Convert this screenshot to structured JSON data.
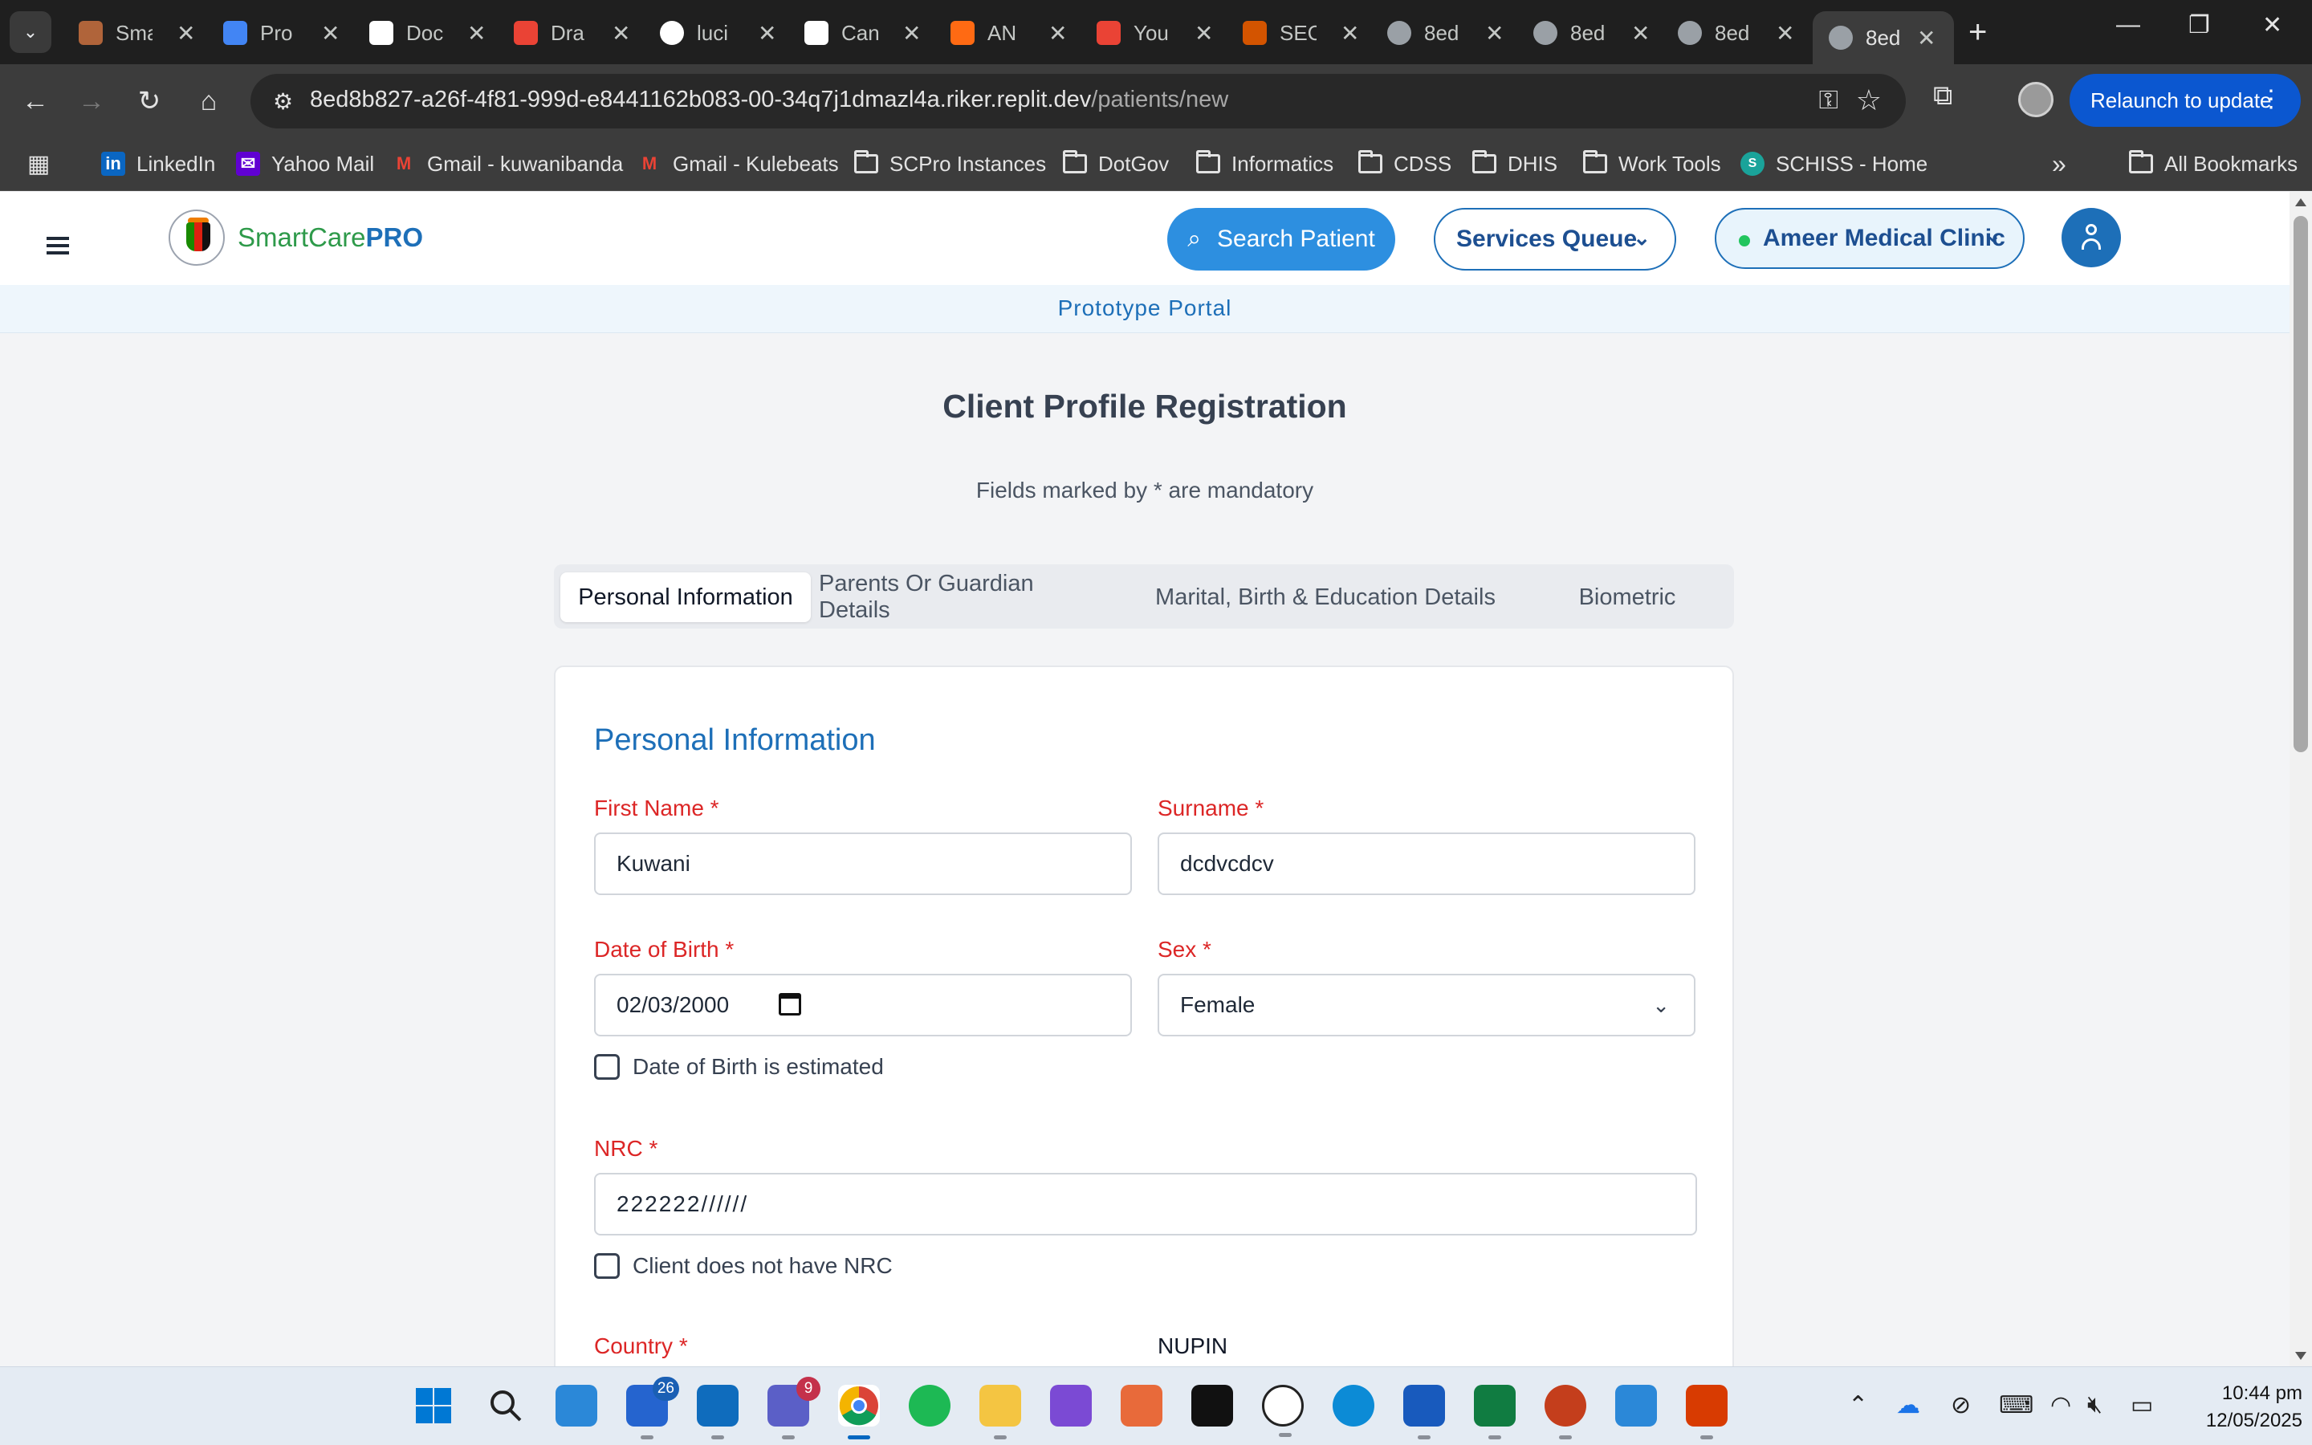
{
  "browser": {
    "tabs": [
      {
        "title": "Sma",
        "favicon_color": "#b0643a"
      },
      {
        "title": "Pro",
        "favicon_color": "#4285f4"
      },
      {
        "title": "Doc",
        "favicon_color": "#ffffff"
      },
      {
        "title": "Dra",
        "favicon_color": "#ea4335"
      },
      {
        "title": "luci",
        "favicon_color": "#ffffff"
      },
      {
        "title": "Can",
        "favicon_color": "#ffffff"
      },
      {
        "title": "AN",
        "favicon_color": "#ff6a13"
      },
      {
        "title": "You",
        "favicon_color": "#ea4335"
      },
      {
        "title": "SEC",
        "favicon_color": "#d35400"
      },
      {
        "title": "8ed",
        "favicon_color": "#9aa0a6"
      },
      {
        "title": "8ed",
        "favicon_color": "#9aa0a6"
      },
      {
        "title": "8ed",
        "favicon_color": "#9aa0a6"
      },
      {
        "title": "8ed",
        "favicon_color": "#9aa0a6",
        "active": true
      }
    ],
    "url_host": "8ed8b827-a26f-4f81-999d-e8441162b083-00-34q7j1dmazl4a.riker.replit.dev",
    "url_path": "/patients/new",
    "relaunch_label": "Relaunch to update",
    "bookmarks": [
      {
        "label": "LinkedIn",
        "icon": "linkedin-icon"
      },
      {
        "label": "Yahoo Mail",
        "icon": "yahoo-icon"
      },
      {
        "label": "Gmail - kuwanibanda",
        "icon": "gmail-icon"
      },
      {
        "label": "Gmail - Kulebeats",
        "icon": "gmail-icon"
      },
      {
        "label": "SCPro Instances",
        "icon": "folder-icon"
      },
      {
        "label": "DotGov",
        "icon": "folder-icon"
      },
      {
        "label": "Informatics",
        "icon": "folder-icon"
      },
      {
        "label": "CDSS",
        "icon": "folder-icon"
      },
      {
        "label": "DHIS",
        "icon": "folder-icon"
      },
      {
        "label": "Work Tools",
        "icon": "folder-icon"
      },
      {
        "label": "SCHISS - Home",
        "icon": "schiss-icon"
      }
    ],
    "all_bookmarks": "All Bookmarks"
  },
  "app": {
    "brand_main": "SmartCare",
    "brand_bold": "PRO",
    "search_patient": "Search Patient",
    "services_queue": "Services Queue",
    "clinic": "Ameer Medical Clinic",
    "portal": "Prototype Portal"
  },
  "form": {
    "title": "Client Profile Registration",
    "subtitle": "Fields marked by * are mandatory",
    "tabs": [
      "Personal Information",
      "Parents Or Guardian Details",
      "Marital, Birth & Education Details",
      "Biometric"
    ],
    "section_title": "Personal Information",
    "first_name_label": "First Name *",
    "first_name_value": "Kuwani",
    "surname_label": "Surname *",
    "surname_value": "dcdvcdcv",
    "dob_label": "Date of Birth *",
    "dob_value": "02/03/2000",
    "sex_label": "Sex *",
    "sex_value": "Female",
    "dob_estimated_label": "Date of Birth is estimated",
    "nrc_label": "NRC *",
    "nrc_value": "222222//////",
    "no_nrc_label": "Client does not have NRC",
    "country_label": "Country *",
    "nupin_label": "NUPIN"
  },
  "taskbar": {
    "badges": {
      "todo": "26",
      "teams": "9"
    },
    "time": "10:44 pm",
    "date": "12/05/2025"
  }
}
